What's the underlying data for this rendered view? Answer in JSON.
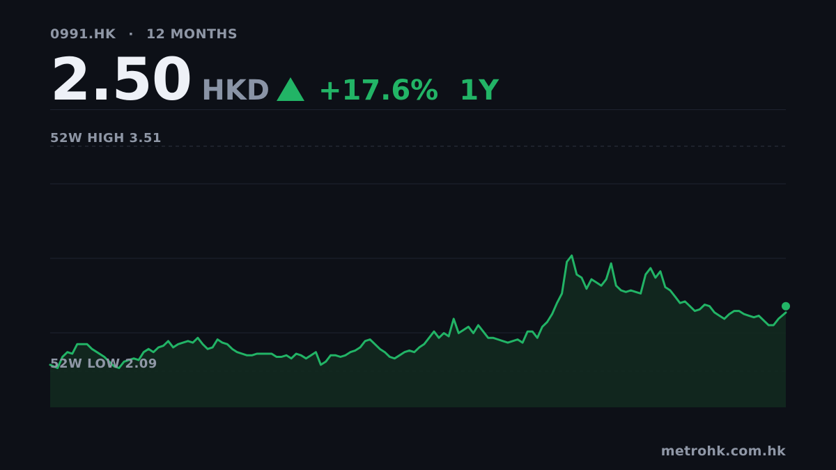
{
  "header": {
    "ticker": "0991.HK",
    "separator": "·",
    "period_label": "12 MONTHS",
    "price": "2.50",
    "currency": "HKD",
    "change_pct": "+17.6%",
    "change_period": "1Y"
  },
  "footer": {
    "source": "metrohk.com.hk"
  },
  "colors": {
    "background": "#0d1017",
    "accent_up": "#22b466",
    "area_fill": "#12291f",
    "muted_text": "#8f97a6",
    "gridline": "#1e2330"
  },
  "chart_data": {
    "type": "area",
    "title": "",
    "xlabel": "",
    "ylabel": "",
    "x_range": [
      0,
      299
    ],
    "ylim": [
      1.98,
      3.51
    ],
    "grid": true,
    "legend": "none",
    "high_label": "52W HIGH",
    "high_value": "3.51",
    "high": 3.51,
    "low_label": "52W LOW",
    "low_value": "2.09",
    "low": 2.09,
    "last_value": 2.5,
    "x": [
      0,
      3,
      5,
      7,
      9,
      11,
      13,
      15,
      17,
      19,
      22,
      24,
      26,
      28,
      30,
      32,
      34,
      36,
      38,
      40,
      42,
      44,
      46,
      48,
      50,
      52,
      54,
      56,
      58,
      60,
      62,
      64,
      66,
      68,
      70,
      72,
      74,
      76,
      78,
      80,
      82,
      84,
      86,
      88,
      90,
      92,
      94,
      96,
      98,
      100,
      102,
      104,
      106,
      108,
      110,
      112,
      114,
      116,
      118,
      120,
      122,
      124,
      126,
      128,
      130,
      132,
      134,
      136,
      138,
      140,
      142,
      144,
      146,
      148,
      150,
      152,
      154,
      156,
      158,
      160,
      162,
      164,
      166,
      168,
      170,
      172,
      174,
      176,
      178,
      180,
      182,
      184,
      186,
      188,
      190,
      192,
      194,
      196,
      198,
      200,
      202,
      204,
      206,
      208,
      210,
      212,
      214,
      216,
      218,
      220,
      222,
      224,
      226,
      228,
      230,
      232,
      234,
      236,
      238,
      240,
      242,
      244,
      246,
      248,
      250,
      252,
      254,
      256,
      258,
      260,
      262,
      264,
      266,
      268,
      270,
      272,
      274,
      276,
      278,
      280,
      282,
      284,
      286,
      288,
      290,
      292,
      294,
      296,
      299
    ],
    "y": [
      2.13,
      2.11,
      2.18,
      2.21,
      2.2,
      2.26,
      2.26,
      2.26,
      2.23,
      2.21,
      2.18,
      2.15,
      2.12,
      2.11,
      2.15,
      2.16,
      2.17,
      2.16,
      2.21,
      2.23,
      2.21,
      2.24,
      2.25,
      2.28,
      2.24,
      2.26,
      2.27,
      2.28,
      2.27,
      2.3,
      2.26,
      2.23,
      2.24,
      2.29,
      2.27,
      2.26,
      2.23,
      2.21,
      2.2,
      2.19,
      2.19,
      2.2,
      2.2,
      2.2,
      2.2,
      2.18,
      2.18,
      2.19,
      2.17,
      2.2,
      2.19,
      2.17,
      2.19,
      2.21,
      2.13,
      2.15,
      2.19,
      2.19,
      2.18,
      2.19,
      2.21,
      2.22,
      2.24,
      2.28,
      2.29,
      2.26,
      2.23,
      2.21,
      2.18,
      2.17,
      2.19,
      2.21,
      2.22,
      2.21,
      2.24,
      2.26,
      2.3,
      2.34,
      2.3,
      2.33,
      2.31,
      2.42,
      2.33,
      2.35,
      2.37,
      2.33,
      2.38,
      2.34,
      2.3,
      2.3,
      2.29,
      2.28,
      2.27,
      2.28,
      2.29,
      2.27,
      2.34,
      2.34,
      2.3,
      2.37,
      2.4,
      2.45,
      2.52,
      2.58,
      2.78,
      2.82,
      2.7,
      2.68,
      2.61,
      2.67,
      2.65,
      2.63,
      2.67,
      2.77,
      2.63,
      2.6,
      2.59,
      2.6,
      2.59,
      2.58,
      2.7,
      2.74,
      2.68,
      2.72,
      2.62,
      2.6,
      2.56,
      2.52,
      2.53,
      2.5,
      2.47,
      2.48,
      2.51,
      2.5,
      2.46,
      2.44,
      2.42,
      2.45,
      2.47,
      2.47,
      2.45,
      2.44,
      2.43,
      2.44,
      2.41,
      2.38,
      2.38,
      2.42,
      2.46,
      2.42,
      2.44,
      2.42,
      2.5
    ]
  }
}
